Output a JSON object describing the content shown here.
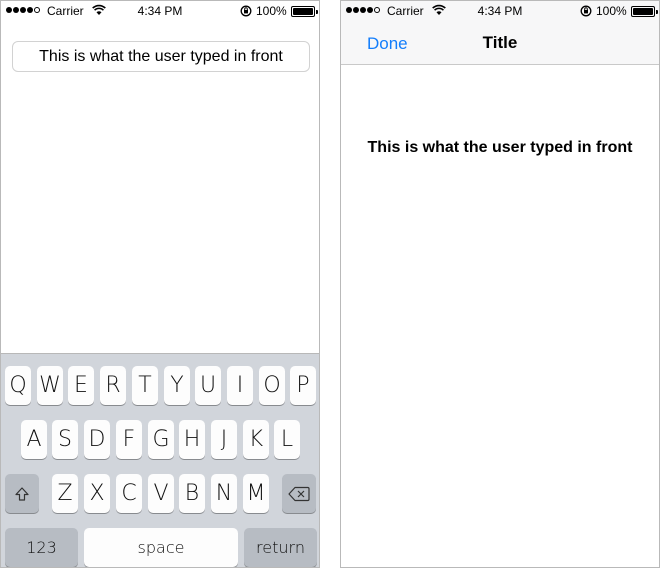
{
  "left_screen": {
    "status_bar": {
      "carrier": "Carrier",
      "time": "4:34 PM",
      "battery": "100%"
    },
    "text_field": {
      "value": "This is what the user typed in front"
    },
    "keyboard": {
      "row1": [
        "Q",
        "W",
        "E",
        "R",
        "T",
        "Y",
        "U",
        "I",
        "O",
        "P"
      ],
      "row2": [
        "A",
        "S",
        "D",
        "F",
        "G",
        "H",
        "J",
        "K",
        "L"
      ],
      "row3": [
        "Z",
        "X",
        "C",
        "V",
        "B",
        "N",
        "M"
      ],
      "numbers_label": "123",
      "space_label": "space",
      "return_label": "return",
      "shift_icon": "shift-icon",
      "delete_icon": "delete-icon"
    }
  },
  "right_screen": {
    "status_bar": {
      "carrier": "Carrier",
      "time": "4:34 PM",
      "battery": "100%"
    },
    "nav": {
      "done_label": "Done",
      "title": "Title"
    },
    "display_text": "This is what the user typed in front"
  },
  "colors": {
    "tint": "#147efb",
    "keyboard_bg": "#d1d5db",
    "key_bg": "#fdfdfd",
    "dark_key_bg": "#b7bcc3"
  }
}
